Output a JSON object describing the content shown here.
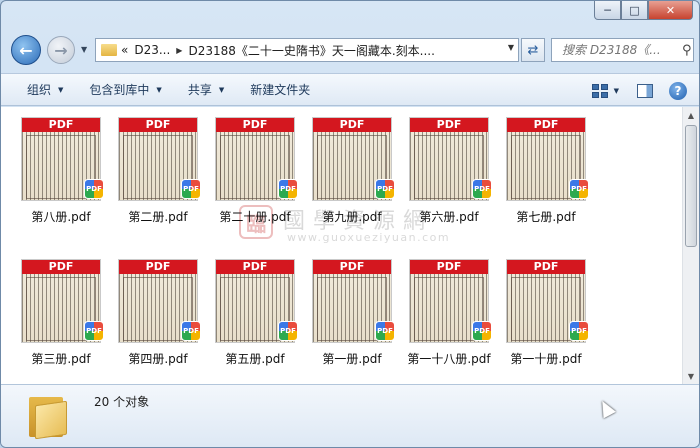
{
  "window": {
    "controls": {
      "minimize": "─",
      "maximize": "□",
      "close": "✕"
    }
  },
  "nav": {
    "back_glyph": "←",
    "forward_glyph": "→",
    "breadcrumb": {
      "lead": "«",
      "items": [
        "D23...",
        "D23188《二十一史隋书》天一阁藏本.刻本...."
      ]
    },
    "search_placeholder": "搜索 D23188《..."
  },
  "toolbar": {
    "items": [
      "组织",
      "包含到库中",
      "共享",
      "新建文件夹"
    ],
    "help_glyph": "?"
  },
  "files": [
    {
      "name": "第八册.pdf"
    },
    {
      "name": "第二册.pdf"
    },
    {
      "name": "第二十册.pdf"
    },
    {
      "name": "第九册.pdf"
    },
    {
      "name": "第六册.pdf"
    },
    {
      "name": "第七册.pdf"
    },
    {
      "name": "第三册.pdf"
    },
    {
      "name": "第四册.pdf"
    },
    {
      "name": "第五册.pdf"
    },
    {
      "name": "第一册.pdf"
    },
    {
      "name": "第一十八册.pdf"
    },
    {
      "name": "第一十册.pdf"
    }
  ],
  "thumbnail": {
    "badge_text": "PDF",
    "badge_icon": "pdf-app-icon"
  },
  "watermark": {
    "seal": "臨",
    "text": "國學資源網",
    "url": "www.guoxueziyuan.com"
  },
  "status": {
    "count_text": "20 个对象"
  },
  "colors": {
    "pdf_red": "#d4171f",
    "titlebar": "#d7e6f5",
    "toolbar": "#dfe9f5"
  }
}
